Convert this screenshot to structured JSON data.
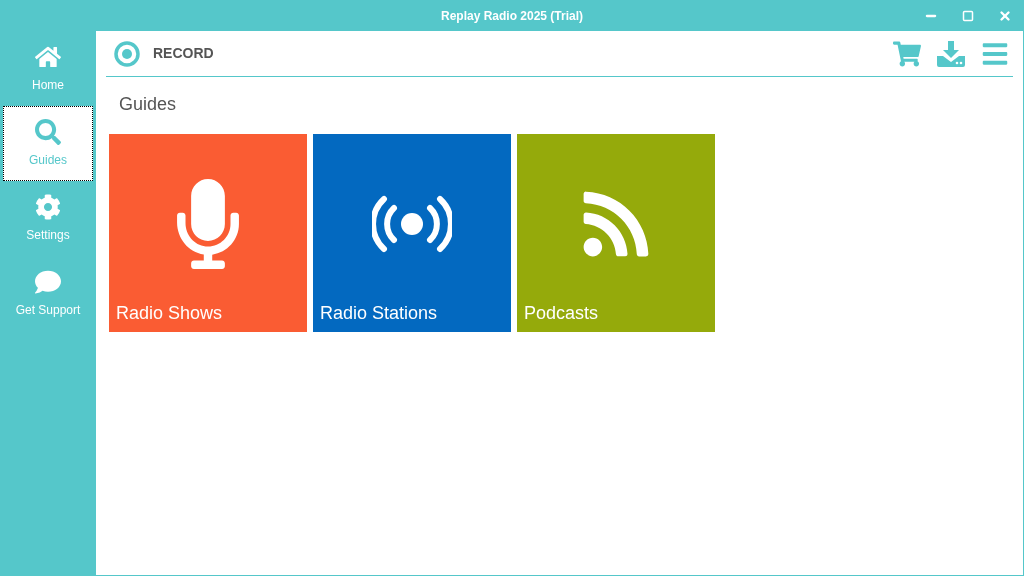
{
  "window": {
    "title": "Replay Radio 2025 (Trial)"
  },
  "sidebar": {
    "items": [
      {
        "label": "Home",
        "kind": "home",
        "selected": false
      },
      {
        "label": "Guides",
        "kind": "search",
        "selected": true
      },
      {
        "label": "Settings",
        "kind": "settings",
        "selected": false
      },
      {
        "label": "Get Support",
        "kind": "support",
        "selected": false
      }
    ]
  },
  "header": {
    "label": "RECORD"
  },
  "section": {
    "title": "Guides"
  },
  "tiles": [
    {
      "label": "Radio Shows",
      "kind": "microphone",
      "color": "#fa5c33"
    },
    {
      "label": "Radio Stations",
      "kind": "broadcast",
      "color": "#0369c0"
    },
    {
      "label": "Podcasts",
      "kind": "rss",
      "color": "#95aa0b"
    }
  ]
}
